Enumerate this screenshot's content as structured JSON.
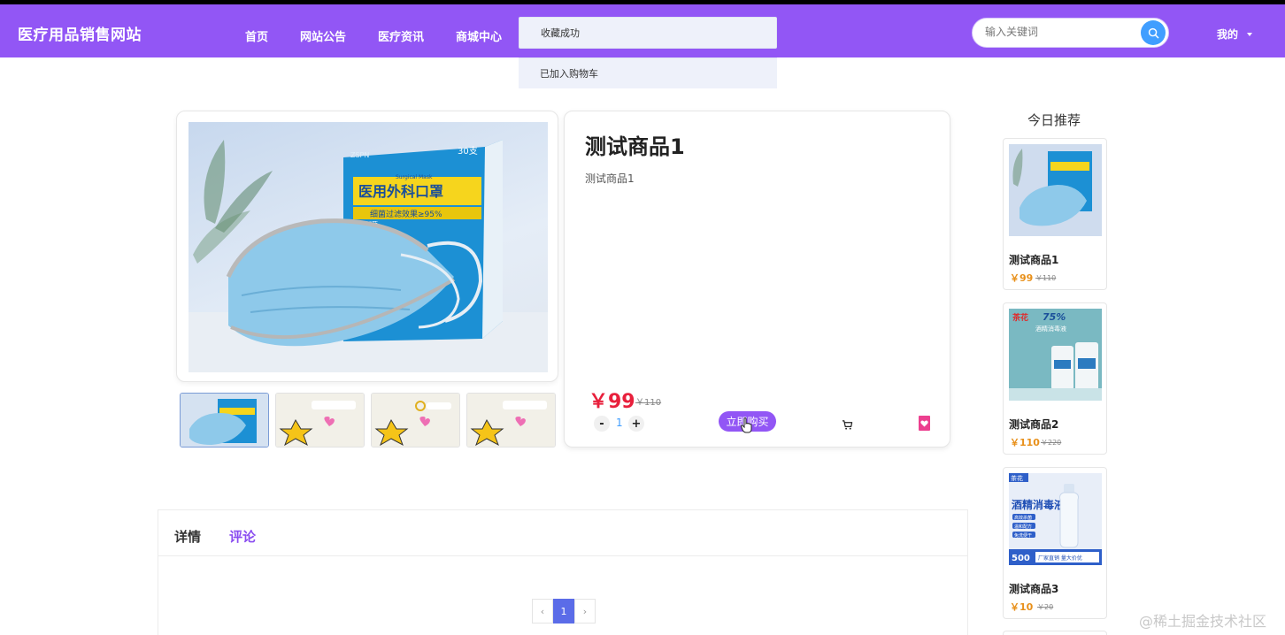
{
  "header": {
    "brand": "医疗用品销售网站",
    "nav": [
      "首页",
      "网站公告",
      "医疗资讯",
      "商城中心"
    ],
    "search_placeholder": "输入关键词",
    "user_menu": "我的"
  },
  "toasts": [
    "收藏成功",
    "已加入购物车"
  ],
  "product": {
    "title": "测试商品1",
    "description": "测试商品1",
    "price": "￥99",
    "old_price": "￥110",
    "quantity": "1",
    "buy_label": "立即购买",
    "box_count": "30支",
    "box_brand": "ZSPN",
    "box_title": "医用外科口罩",
    "box_subtitle": "Surgical Mask",
    "box_filter": "细菌过滤效果≥95%",
    "box_badge": "阻隔细菌"
  },
  "tabs": {
    "detail": "详情",
    "comment": "评论"
  },
  "pagination": {
    "prev": "‹",
    "current": "1",
    "next": "›"
  },
  "recommend": {
    "title": "今日推荐",
    "items": [
      {
        "name": "测试商品1",
        "price": "￥99",
        "old_price": "￥110"
      },
      {
        "name": "测试商品2",
        "price": "￥110",
        "old_price": "￥220",
        "img_brand": "茶花",
        "img_pct": "75%",
        "img_text": "酒精消毒液"
      },
      {
        "name": "测试商品3",
        "price": "￥10",
        "old_price": "￥20",
        "img_brand": "茶花",
        "img_title": "酒精消毒液",
        "img_tags": [
          "高效杀菌",
          "温和配方",
          "免洗便干"
        ],
        "img_volume": "500",
        "img_banner": "厂家直销 量大价优"
      }
    ]
  },
  "watermark": "@稀土掘金技术社区",
  "colors": {
    "nav_bg": "#9256f5",
    "price_red": "#e8203c",
    "accent_purple": "#9256f5",
    "rec_price": "#e8901a"
  }
}
